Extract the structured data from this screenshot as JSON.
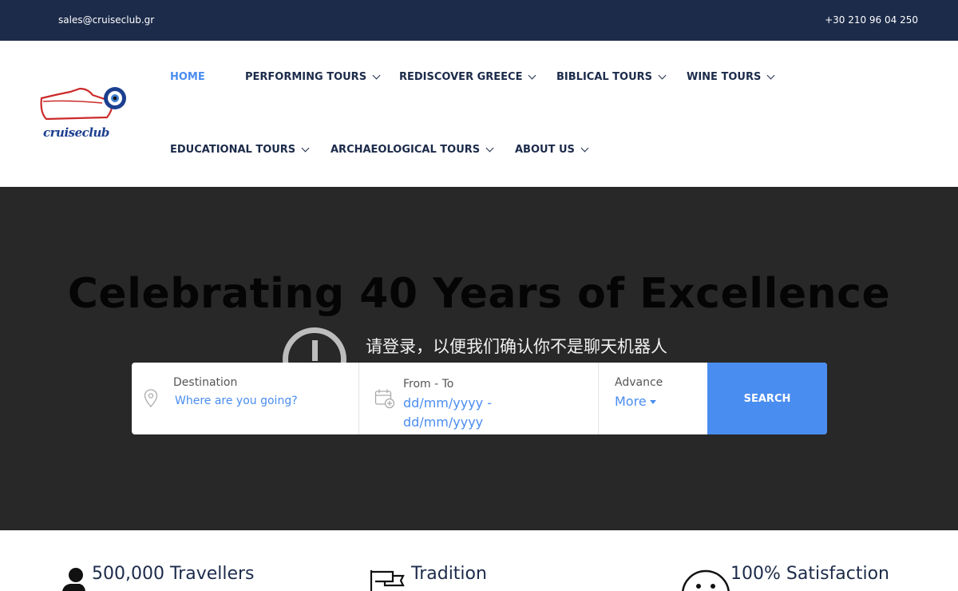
{
  "topbar": {
    "email": "sales@cruiseclub.gr",
    "phone": "+30 210 96 04 250"
  },
  "logo": {
    "text": "cruiseclub"
  },
  "nav": {
    "items": [
      {
        "label": "HOME",
        "active": true,
        "dropdown": false
      },
      {
        "label": "PERFORMING TOURS",
        "active": false,
        "dropdown": true
      },
      {
        "label": "REDISCOVER GREECE",
        "active": false,
        "dropdown": true
      },
      {
        "label": "BIBLICAL TOURS",
        "active": false,
        "dropdown": true
      },
      {
        "label": "WINE TOURS",
        "active": false,
        "dropdown": true
      },
      {
        "label": "EDUCATIONAL TOURS",
        "active": false,
        "dropdown": true
      },
      {
        "label": "ARCHAEOLOGICAL TOURS",
        "active": false,
        "dropdown": true
      },
      {
        "label": "ABOUT US",
        "active": false,
        "dropdown": true
      }
    ]
  },
  "hero": {
    "title": "Celebrating 40 Years of Excellence",
    "captcha_text": "请登录，以便我们确认你不是聊天机器人"
  },
  "search": {
    "destination": {
      "label": "Destination",
      "placeholder": "Where are you going?"
    },
    "dates": {
      "label": "From - To",
      "value_line1": "dd/mm/yyyy -",
      "value_line2": "dd/mm/yyyy"
    },
    "advance": {
      "label": "Advance",
      "more": "More"
    },
    "button": "SEARCH"
  },
  "features": [
    {
      "label": "500,000 Travellers",
      "icon": "person-icon"
    },
    {
      "label": "Tradition",
      "icon": "flag-icon"
    },
    {
      "label": "100% Satisfaction",
      "icon": "smiley-icon"
    }
  ],
  "colors": {
    "navy": "#1c2b4a",
    "accent": "#4a8df0",
    "hero_bg": "#282828"
  }
}
